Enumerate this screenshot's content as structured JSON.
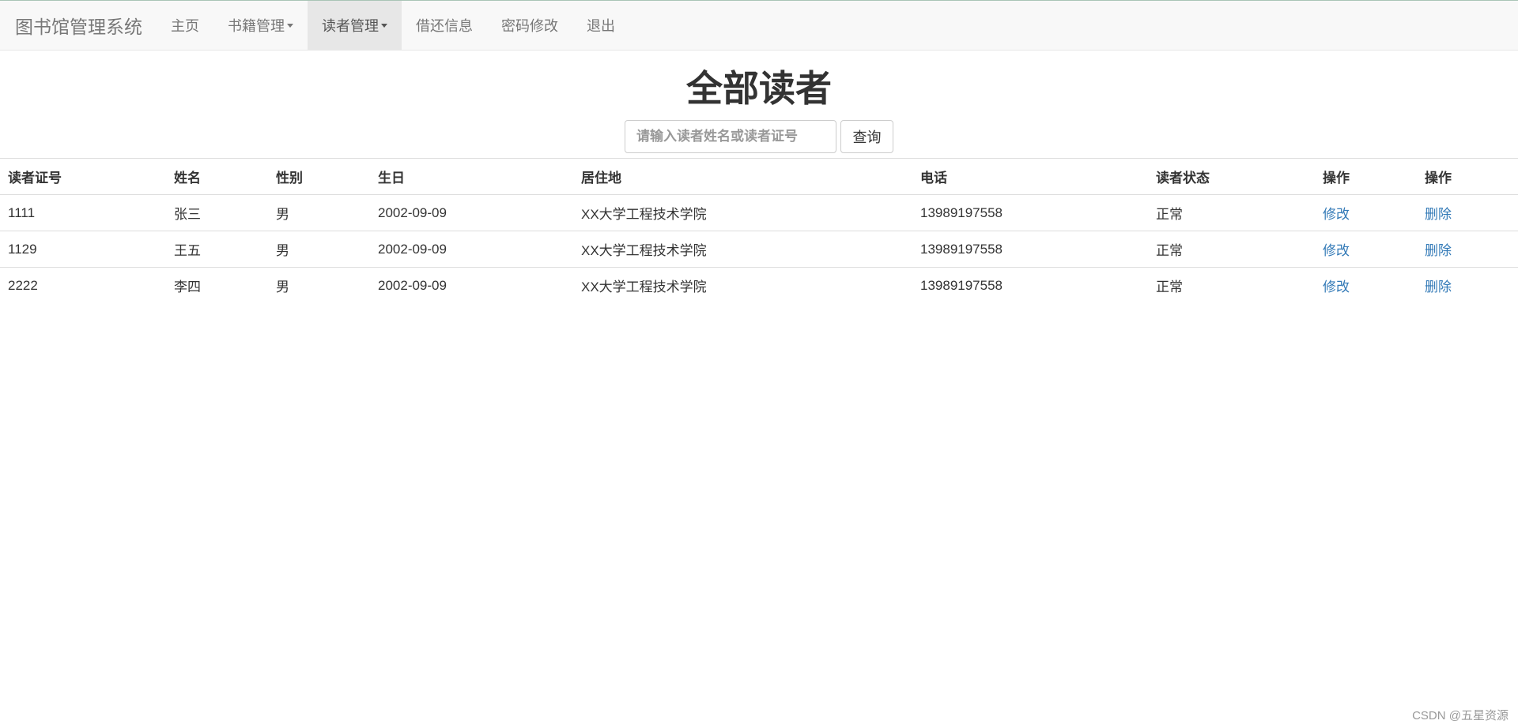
{
  "navbar": {
    "brand": "图书馆管理系统",
    "items": [
      {
        "label": "主页",
        "dropdown": false,
        "active": false
      },
      {
        "label": "书籍管理",
        "dropdown": true,
        "active": false
      },
      {
        "label": "读者管理",
        "dropdown": true,
        "active": true
      },
      {
        "label": "借还信息",
        "dropdown": false,
        "active": false
      },
      {
        "label": "密码修改",
        "dropdown": false,
        "active": false
      },
      {
        "label": "退出",
        "dropdown": false,
        "active": false
      }
    ]
  },
  "page": {
    "title": "全部读者"
  },
  "search": {
    "value": "",
    "placeholder": "请输入读者姓名或读者证号",
    "button_label": "查询"
  },
  "table": {
    "headers": [
      "读者证号",
      "姓名",
      "性别",
      "生日",
      "居住地",
      "电话",
      "读者状态",
      "操作",
      "操作"
    ],
    "rows": [
      {
        "id": "1111",
        "name": "张三",
        "gender": "男",
        "birthday": "2002-09-09",
        "address": "XX大学工程技术学院",
        "phone": "13989197558",
        "status": "正常",
        "edit": "修改",
        "delete": "删除"
      },
      {
        "id": "1129",
        "name": "王五",
        "gender": "男",
        "birthday": "2002-09-09",
        "address": "XX大学工程技术学院",
        "phone": "13989197558",
        "status": "正常",
        "edit": "修改",
        "delete": "删除"
      },
      {
        "id": "2222",
        "name": "李四",
        "gender": "男",
        "birthday": "2002-09-09",
        "address": "XX大学工程技术学院",
        "phone": "13989197558",
        "status": "正常",
        "edit": "修改",
        "delete": "删除"
      }
    ]
  },
  "watermark": "CSDN @五星资源",
  "colors": {
    "link": "#337ab7",
    "navbar_bg": "#f8f8f8",
    "active_nav_bg": "#e7e7e7"
  }
}
